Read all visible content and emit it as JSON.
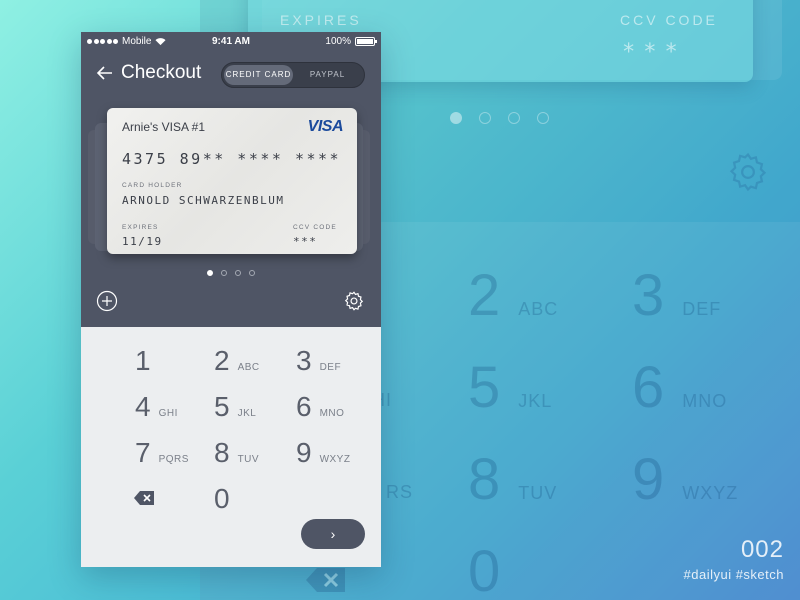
{
  "status_bar": {
    "carrier": "Mobile",
    "time": "9:41 AM",
    "battery": "100%"
  },
  "nav": {
    "title": "Checkout",
    "tabs": [
      {
        "label": "CREDIT CARD",
        "active": true
      },
      {
        "label": "PAYPAL",
        "active": false
      }
    ]
  },
  "card": {
    "name": "Arnie's VISA #1",
    "brand": "VISA",
    "number": "4375 89** **** ****",
    "holder_label": "CARD HOLDER",
    "holder": "ARNOLD SCHWARZENBLUM",
    "expires_label": "EXPIRES",
    "expires": "11/19",
    "ccv_label": "CCV CODE",
    "ccv": "***"
  },
  "pager": {
    "count": 4,
    "active": 0
  },
  "keypad": {
    "keys": [
      {
        "digit": "1",
        "letters": ""
      },
      {
        "digit": "2",
        "letters": "ABC"
      },
      {
        "digit": "3",
        "letters": "DEF"
      },
      {
        "digit": "4",
        "letters": "GHI"
      },
      {
        "digit": "5",
        "letters": "JKL"
      },
      {
        "digit": "6",
        "letters": "MNO"
      },
      {
        "digit": "7",
        "letters": "PQRS"
      },
      {
        "digit": "8",
        "letters": "TUV"
      },
      {
        "digit": "9",
        "letters": "WXYZ"
      },
      {
        "digit": "0",
        "letters": ""
      }
    ],
    "next_label": "›"
  },
  "background": {
    "expires_label": "EXPIRES",
    "ccv_label": "CCV CODE",
    "ccv_value": "***",
    "keys": [
      {
        "digit": "2",
        "letters": "ABC"
      },
      {
        "digit": "3",
        "letters": "DEF"
      },
      {
        "digit": "5",
        "letters": "JKL"
      },
      {
        "digit": "6",
        "letters": "MNO"
      },
      {
        "digit": "8",
        "letters": "TUV"
      },
      {
        "digit": "9",
        "letters": "WXYZ"
      },
      {
        "digit": "0",
        "letters": ""
      },
      {
        "digit": "",
        "letters": "HI"
      },
      {
        "digit": "",
        "letters": "RS"
      }
    ]
  },
  "footer": {
    "number": "002",
    "tags": "#dailyui #sketch"
  },
  "colors": {
    "dark": "#4f5565",
    "visa_blue": "#1b4a9c",
    "visa_gold": "#e8a92a",
    "keypad_bg": "#eceef0"
  }
}
